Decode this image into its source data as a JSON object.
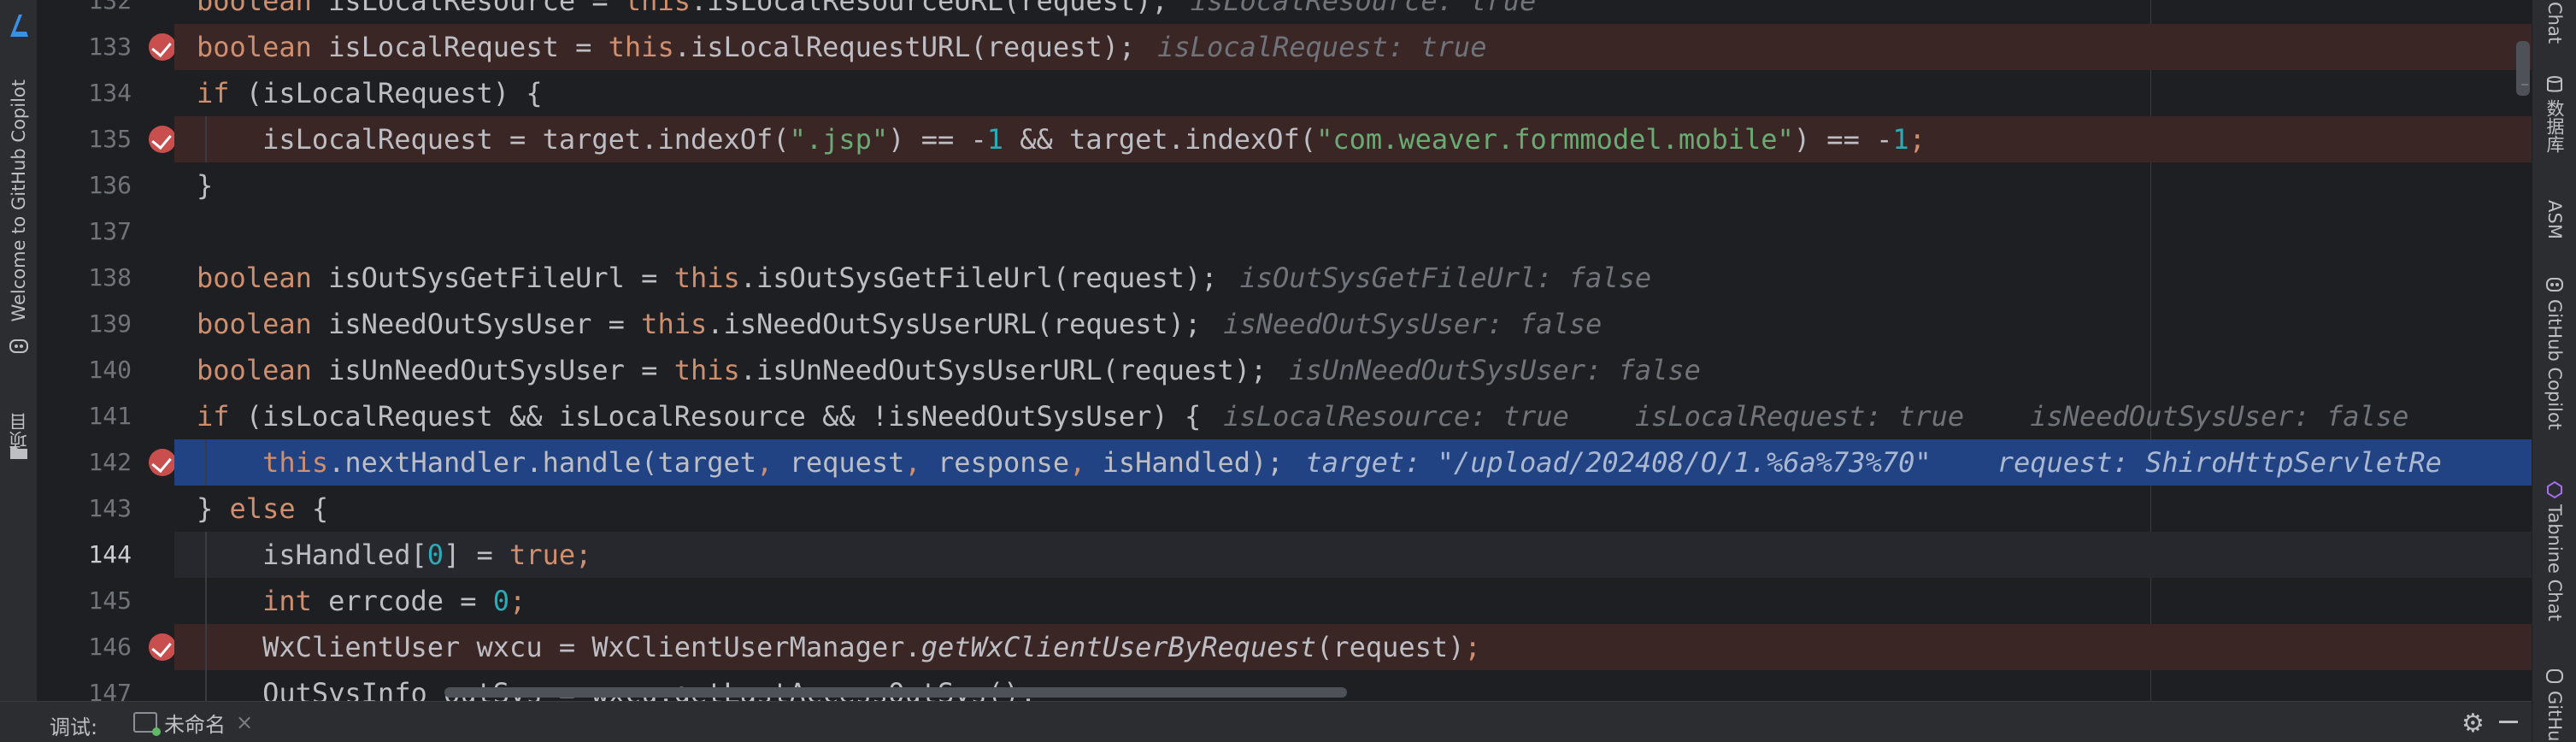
{
  "left_tools": {
    "copilot_welcome": "Welcome to GitHub Copilot",
    "project": "项目"
  },
  "right_tools": {
    "chat": "Chat",
    "database": "数据库",
    "asm": "ASM",
    "github_copilot": "GitHub Copilot",
    "tabnine_chat": "Tabnine Chat",
    "github": "GitHu"
  },
  "editor": {
    "lines": [
      {
        "num": "132",
        "segments": [
          [
            "kw",
            "boolean "
          ],
          [
            "",
            "isLocalResource = "
          ],
          [
            "kw",
            "this"
          ],
          [
            "",
            ".isLocalResourceURL(request);"
          ]
        ],
        "inline": "isLocalResource: true",
        "breakpoint": false,
        "fold": false
      },
      {
        "num": "133",
        "segments": [
          [
            "kw",
            "boolean "
          ],
          [
            "",
            "isLocalRequest = "
          ],
          [
            "kw",
            "this"
          ],
          [
            "",
            ".isLocalRequestURL(request);"
          ]
        ],
        "inline": "isLocalRequest: true",
        "breakpoint": true,
        "fold": false
      },
      {
        "num": "134",
        "segments": [
          [
            "kw",
            "if "
          ],
          [
            "",
            "(isLocalRequest) {"
          ]
        ],
        "inline": "",
        "breakpoint": false,
        "fold": true
      },
      {
        "num": "135",
        "segments": [
          [
            "",
            "    isLocalRequest = target.indexOf("
          ],
          [
            "str",
            "\".jsp\""
          ],
          [
            "",
            ") == -"
          ],
          [
            "num",
            "1"
          ],
          [
            "",
            " && target.indexOf("
          ],
          [
            "str",
            "\"com.weaver.formmodel.mobile\""
          ],
          [
            "",
            ") == -"
          ],
          [
            "num",
            "1"
          ],
          [
            "kw",
            ";"
          ]
        ],
        "inline": "",
        "breakpoint": true,
        "fold": false
      },
      {
        "num": "136",
        "segments": [
          [
            "",
            "}"
          ]
        ],
        "inline": "",
        "breakpoint": false,
        "fold": true
      },
      {
        "num": "137",
        "segments": [],
        "inline": "",
        "breakpoint": false,
        "fold": false
      },
      {
        "num": "138",
        "segments": [
          [
            "kw",
            "boolean "
          ],
          [
            "",
            "isOutSysGetFileUrl = "
          ],
          [
            "kw",
            "this"
          ],
          [
            "",
            ".isOutSysGetFileUrl(request);"
          ]
        ],
        "inline": "isOutSysGetFileUrl: false",
        "breakpoint": false,
        "fold": false
      },
      {
        "num": "139",
        "segments": [
          [
            "kw",
            "boolean "
          ],
          [
            "",
            "isNeedOutSysUser = "
          ],
          [
            "kw",
            "this"
          ],
          [
            "",
            ".isNeedOutSysUserURL(request);"
          ]
        ],
        "inline": "isNeedOutSysUser: false",
        "breakpoint": false,
        "fold": false
      },
      {
        "num": "140",
        "segments": [
          [
            "kw",
            "boolean "
          ],
          [
            "",
            "isUnNeedOutSysUser = "
          ],
          [
            "kw",
            "this"
          ],
          [
            "",
            ".isUnNeedOutSysUserURL(request);"
          ]
        ],
        "inline": "isUnNeedOutSysUser: false",
        "breakpoint": false,
        "fold": false
      },
      {
        "num": "141",
        "segments": [
          [
            "kw",
            "if "
          ],
          [
            "",
            "(isLocalRequest && isLocalResource && !isNeedOutSysUser) {"
          ]
        ],
        "inline": "isLocalResource: true    isLocalRequest: true    isNeedOutSysUser: false",
        "breakpoint": false,
        "fold": true
      },
      {
        "num": "142",
        "segments": [
          [
            "kw",
            "    this"
          ],
          [
            "",
            ".nextHandler.handle(target"
          ],
          [
            "kw",
            ", "
          ],
          [
            "",
            "request"
          ],
          [
            "kw",
            ", "
          ],
          [
            "",
            "response"
          ],
          [
            "kw",
            ", "
          ],
          [
            "",
            "isHandled);"
          ]
        ],
        "inline": "target: \"/upload/202408/O/1.%6a%73%70\"    request: ShiroHttpServletRe",
        "breakpoint": true,
        "fold": false,
        "selected": true
      },
      {
        "num": "143",
        "segments": [
          [
            "",
            "} "
          ],
          [
            "kw",
            "else "
          ],
          [
            "",
            "{"
          ]
        ],
        "inline": "",
        "breakpoint": false,
        "fold": true
      },
      {
        "num": "144",
        "segments": [
          [
            "",
            "    isHandled["
          ],
          [
            "num",
            "0"
          ],
          [
            "",
            "] = "
          ],
          [
            "kw",
            "true;"
          ]
        ],
        "inline": "",
        "breakpoint": false,
        "fold": false,
        "current": true
      },
      {
        "num": "145",
        "segments": [
          [
            "kw",
            "    int "
          ],
          [
            "",
            "errcode = "
          ],
          [
            "num",
            "0"
          ],
          [
            "kw",
            ";"
          ]
        ],
        "inline": "",
        "breakpoint": false,
        "fold": false
      },
      {
        "num": "146",
        "segments": [
          [
            "",
            "    WxClientUser wxcu = WxClientUserManager."
          ],
          [
            "italic",
            "getWxClientUserByRequest"
          ],
          [
            "",
            "(request)"
          ],
          [
            "kw",
            ";"
          ]
        ],
        "inline": "",
        "breakpoint": true,
        "fold": false
      },
      {
        "num": "147",
        "segments": [
          [
            "",
            "    OutSysInfo outSys = wxcu.getLastAccessOutSys();"
          ]
        ],
        "inline": "",
        "breakpoint": false,
        "fold": false
      }
    ]
  },
  "bottom_bar": {
    "debug_label": "调试:",
    "session_name": "未命名",
    "close_glyph": "×",
    "settings_glyph": "⚙"
  }
}
